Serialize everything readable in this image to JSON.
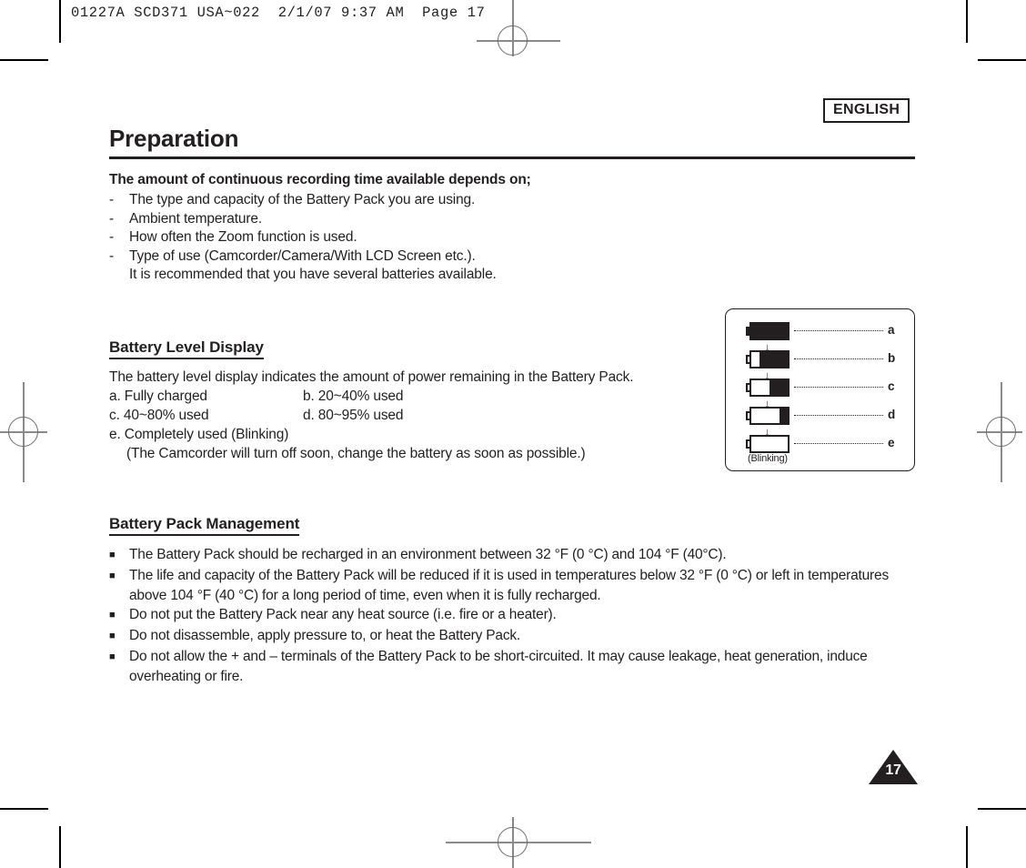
{
  "prepress": {
    "header_line": "01227A SCD371 USA~022  2/1/07 9:37 AM  Page 17"
  },
  "page": {
    "language_badge": "ENGLISH",
    "chapter_title": "Preparation",
    "page_number": "17"
  },
  "intro": {
    "heading": "The amount of continuous recording time available depends on;",
    "items": [
      "The type and capacity of the Battery Pack you are using.",
      "Ambient temperature.",
      "How often the Zoom function is used.",
      "Type of use (Camcorder/Camera/With LCD Screen etc.)."
    ],
    "continuation": "It is recommended that you have several batteries available.",
    "marker": "-"
  },
  "battery_level": {
    "heading": "Battery Level Display",
    "description": "The battery level display indicates the amount of power remaining in the Battery Pack.",
    "states": [
      {
        "left": "a. Fully charged",
        "right": "b. 20~40% used"
      },
      {
        "left": "c. 40~80% used",
        "right": "d. 80~95% used"
      }
    ],
    "state_e": "e. Completely used (Blinking)",
    "state_e_note": "(The Camcorder will turn off soon, change the battery as soon as possible.)"
  },
  "battery_figure": {
    "blinking_caption": "(Blinking)",
    "arrow_glyph": "↓",
    "rows": [
      {
        "label": "a",
        "fill_percent": 100,
        "icon": "battery-full-icon"
      },
      {
        "label": "b",
        "fill_percent": 78,
        "icon": "battery-high-icon"
      },
      {
        "label": "c",
        "fill_percent": 50,
        "icon": "battery-medium-icon"
      },
      {
        "label": "d",
        "fill_percent": 22,
        "icon": "battery-low-icon"
      },
      {
        "label": "e",
        "fill_percent": 0,
        "icon": "battery-empty-icon"
      }
    ]
  },
  "battery_management": {
    "heading": "Battery Pack Management",
    "marker": "■",
    "items": [
      "The Battery Pack should be recharged in an environment between 32 °F (0 °C) and 104 °F (40°C).",
      "The life and capacity of the Battery Pack will be reduced if it is used in temperatures below 32 °F (0 °C) or left in temperatures above 104 °F (40 °C) for a long period of time, even when it is fully recharged.",
      "Do not put the Battery Pack near any heat source (i.e. fire or a heater).",
      "Do not disassemble, apply pressure to, or heat the Battery Pack.",
      "Do not allow the + and – terminals of the Battery Pack to be short-circuited. It may cause leakage, heat generation, induce overheating or fire."
    ]
  },
  "colors": {
    "ink": "#231f20",
    "paper": "#ffffff",
    "mark_gray": "#8a8a8a"
  }
}
